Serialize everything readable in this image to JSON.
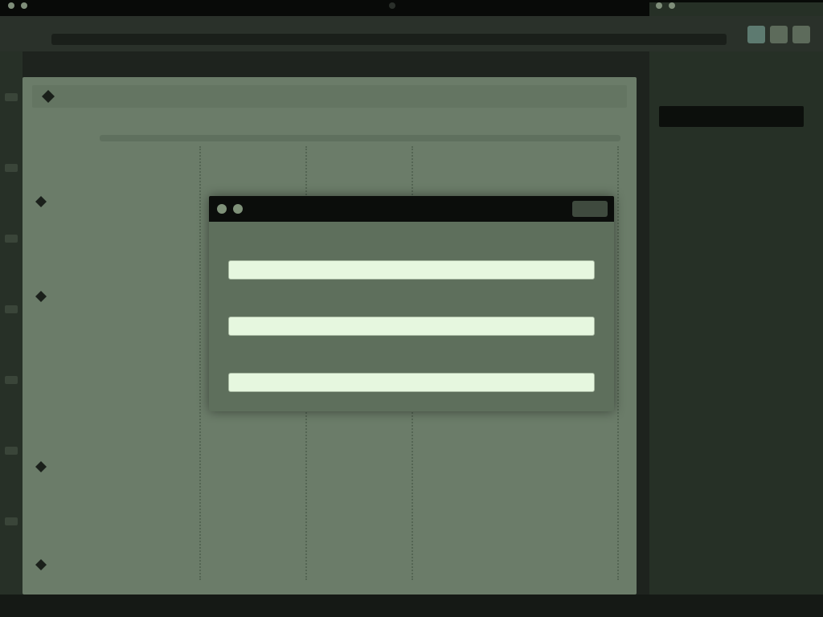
{
  "topbar": {
    "left_text": "",
    "center_text": "",
    "right_text": ""
  },
  "toolbar": {
    "left_text": "",
    "address_text": ""
  },
  "main": {
    "header_text": "",
    "columns": [
      "",
      "",
      "",
      "",
      ""
    ],
    "rows": [
      "",
      "",
      "",
      "",
      "",
      "",
      "",
      "",
      "",
      "",
      "",
      "",
      "",
      "",
      ""
    ]
  },
  "right_panel": {
    "title": "",
    "info": ""
  },
  "modal": {
    "title": "",
    "close_label": "",
    "field1_label": "",
    "field1_value": "",
    "field2_label": "",
    "field2_value": "",
    "field3_label": "",
    "field3_value": ""
  },
  "colors": {
    "panel": "#6b7c69",
    "modal_titlebar": "#0b0d0b",
    "input_bg": "#e6f7df"
  }
}
